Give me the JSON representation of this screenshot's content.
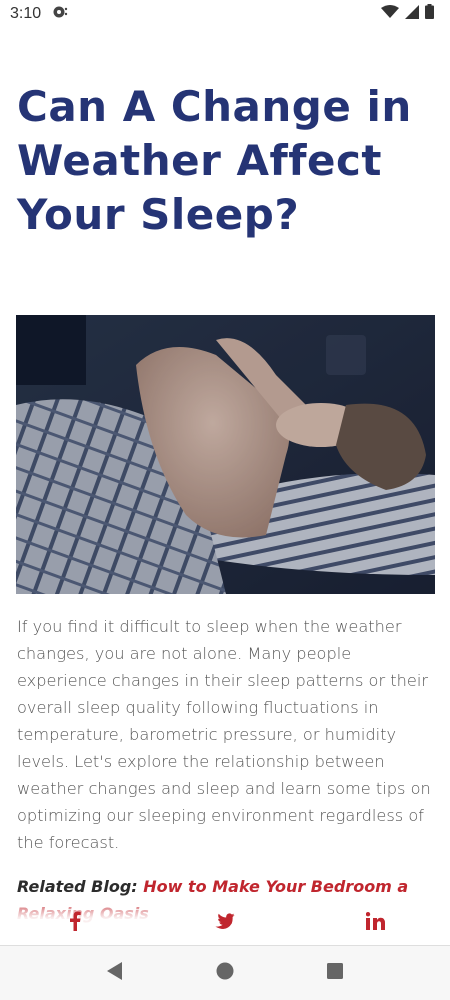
{
  "status_bar": {
    "time": "3:10"
  },
  "article": {
    "title": "Can A Change in Weather Affect Your Sleep?",
    "intro": "If you find it difficult to sleep when the weather changes, you are not alone. Many people experience changes in their sleep patterns or their overall sleep quality following fluctuations in temperature, barometric pressure, or humidity levels. Let's explore the relationship between weather changes and sleep and learn some tips on optimizing our sleeping environment regardless of the forecast.",
    "related_label": "Related Blog:",
    "related_link": "How to Make Your Bedroom a Relaxing Oasis"
  },
  "share": {
    "icons": [
      "facebook-icon",
      "twitter-icon",
      "linkedin-icon"
    ],
    "color": "#c0262e"
  },
  "navigation": {
    "icons": [
      "back-icon",
      "home-icon",
      "recents-icon"
    ]
  },
  "colors": {
    "title": "#253475",
    "link": "#c0262e",
    "body_text": "#555555"
  }
}
